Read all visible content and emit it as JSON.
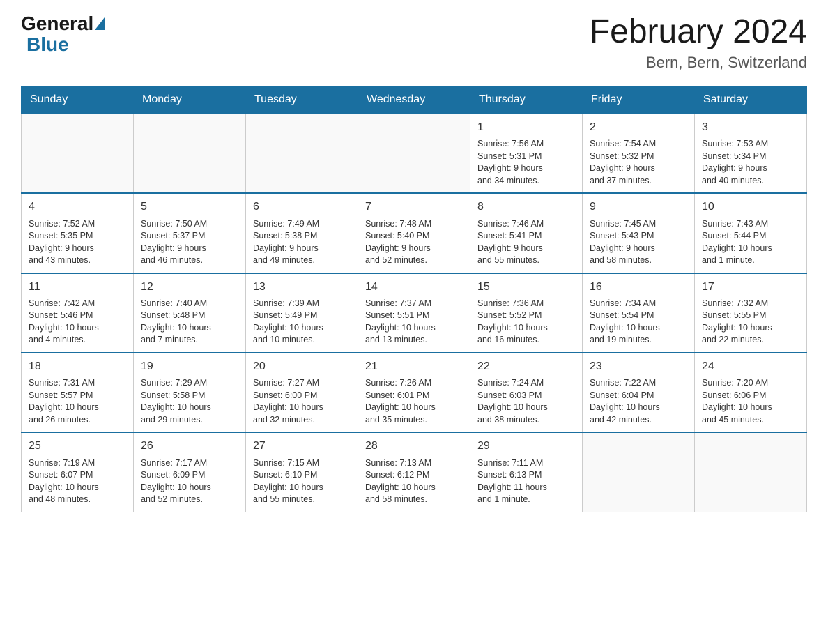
{
  "header": {
    "logo_general": "General",
    "logo_blue": "Blue",
    "month_title": "February 2024",
    "location": "Bern, Bern, Switzerland"
  },
  "weekdays": [
    "Sunday",
    "Monday",
    "Tuesday",
    "Wednesday",
    "Thursday",
    "Friday",
    "Saturday"
  ],
  "weeks": [
    [
      {
        "day": "",
        "info": ""
      },
      {
        "day": "",
        "info": ""
      },
      {
        "day": "",
        "info": ""
      },
      {
        "day": "",
        "info": ""
      },
      {
        "day": "1",
        "info": "Sunrise: 7:56 AM\nSunset: 5:31 PM\nDaylight: 9 hours\nand 34 minutes."
      },
      {
        "day": "2",
        "info": "Sunrise: 7:54 AM\nSunset: 5:32 PM\nDaylight: 9 hours\nand 37 minutes."
      },
      {
        "day": "3",
        "info": "Sunrise: 7:53 AM\nSunset: 5:34 PM\nDaylight: 9 hours\nand 40 minutes."
      }
    ],
    [
      {
        "day": "4",
        "info": "Sunrise: 7:52 AM\nSunset: 5:35 PM\nDaylight: 9 hours\nand 43 minutes."
      },
      {
        "day": "5",
        "info": "Sunrise: 7:50 AM\nSunset: 5:37 PM\nDaylight: 9 hours\nand 46 minutes."
      },
      {
        "day": "6",
        "info": "Sunrise: 7:49 AM\nSunset: 5:38 PM\nDaylight: 9 hours\nand 49 minutes."
      },
      {
        "day": "7",
        "info": "Sunrise: 7:48 AM\nSunset: 5:40 PM\nDaylight: 9 hours\nand 52 minutes."
      },
      {
        "day": "8",
        "info": "Sunrise: 7:46 AM\nSunset: 5:41 PM\nDaylight: 9 hours\nand 55 minutes."
      },
      {
        "day": "9",
        "info": "Sunrise: 7:45 AM\nSunset: 5:43 PM\nDaylight: 9 hours\nand 58 minutes."
      },
      {
        "day": "10",
        "info": "Sunrise: 7:43 AM\nSunset: 5:44 PM\nDaylight: 10 hours\nand 1 minute."
      }
    ],
    [
      {
        "day": "11",
        "info": "Sunrise: 7:42 AM\nSunset: 5:46 PM\nDaylight: 10 hours\nand 4 minutes."
      },
      {
        "day": "12",
        "info": "Sunrise: 7:40 AM\nSunset: 5:48 PM\nDaylight: 10 hours\nand 7 minutes."
      },
      {
        "day": "13",
        "info": "Sunrise: 7:39 AM\nSunset: 5:49 PM\nDaylight: 10 hours\nand 10 minutes."
      },
      {
        "day": "14",
        "info": "Sunrise: 7:37 AM\nSunset: 5:51 PM\nDaylight: 10 hours\nand 13 minutes."
      },
      {
        "day": "15",
        "info": "Sunrise: 7:36 AM\nSunset: 5:52 PM\nDaylight: 10 hours\nand 16 minutes."
      },
      {
        "day": "16",
        "info": "Sunrise: 7:34 AM\nSunset: 5:54 PM\nDaylight: 10 hours\nand 19 minutes."
      },
      {
        "day": "17",
        "info": "Sunrise: 7:32 AM\nSunset: 5:55 PM\nDaylight: 10 hours\nand 22 minutes."
      }
    ],
    [
      {
        "day": "18",
        "info": "Sunrise: 7:31 AM\nSunset: 5:57 PM\nDaylight: 10 hours\nand 26 minutes."
      },
      {
        "day": "19",
        "info": "Sunrise: 7:29 AM\nSunset: 5:58 PM\nDaylight: 10 hours\nand 29 minutes."
      },
      {
        "day": "20",
        "info": "Sunrise: 7:27 AM\nSunset: 6:00 PM\nDaylight: 10 hours\nand 32 minutes."
      },
      {
        "day": "21",
        "info": "Sunrise: 7:26 AM\nSunset: 6:01 PM\nDaylight: 10 hours\nand 35 minutes."
      },
      {
        "day": "22",
        "info": "Sunrise: 7:24 AM\nSunset: 6:03 PM\nDaylight: 10 hours\nand 38 minutes."
      },
      {
        "day": "23",
        "info": "Sunrise: 7:22 AM\nSunset: 6:04 PM\nDaylight: 10 hours\nand 42 minutes."
      },
      {
        "day": "24",
        "info": "Sunrise: 7:20 AM\nSunset: 6:06 PM\nDaylight: 10 hours\nand 45 minutes."
      }
    ],
    [
      {
        "day": "25",
        "info": "Sunrise: 7:19 AM\nSunset: 6:07 PM\nDaylight: 10 hours\nand 48 minutes."
      },
      {
        "day": "26",
        "info": "Sunrise: 7:17 AM\nSunset: 6:09 PM\nDaylight: 10 hours\nand 52 minutes."
      },
      {
        "day": "27",
        "info": "Sunrise: 7:15 AM\nSunset: 6:10 PM\nDaylight: 10 hours\nand 55 minutes."
      },
      {
        "day": "28",
        "info": "Sunrise: 7:13 AM\nSunset: 6:12 PM\nDaylight: 10 hours\nand 58 minutes."
      },
      {
        "day": "29",
        "info": "Sunrise: 7:11 AM\nSunset: 6:13 PM\nDaylight: 11 hours\nand 1 minute."
      },
      {
        "day": "",
        "info": ""
      },
      {
        "day": "",
        "info": ""
      }
    ]
  ]
}
